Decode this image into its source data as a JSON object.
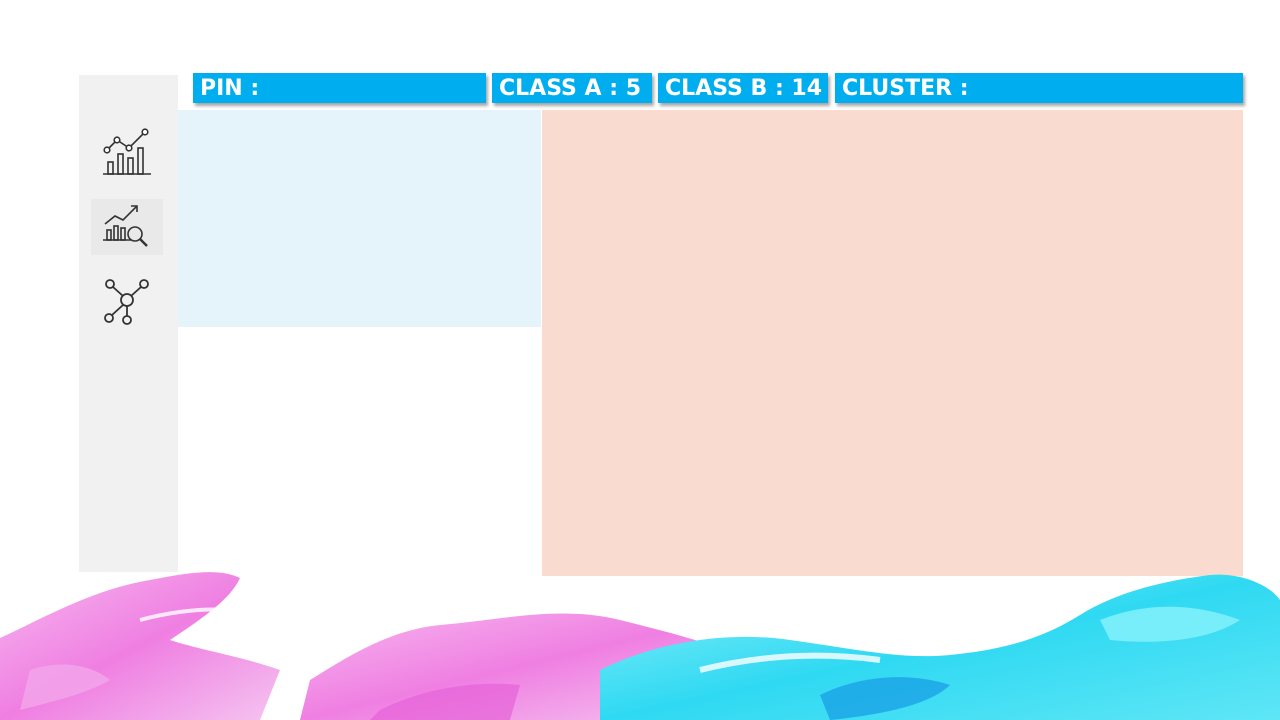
{
  "header": {
    "pin": {
      "label": "PIN :",
      "value": ""
    },
    "class_a": {
      "label": "CLASS A : 5"
    },
    "class_b": {
      "label": "CLASS B : 14"
    },
    "cluster": {
      "label": "CLUSTER :",
      "value": ""
    }
  },
  "sidebar": {
    "items": [
      {
        "icon": "bar-line-chart-icon",
        "active": false
      },
      {
        "icon": "chart-analytics-search-icon",
        "active": true
      },
      {
        "icon": "network-cluster-icon",
        "active": false
      }
    ]
  },
  "colors": {
    "header_bar": "#00aeef",
    "sidebar_bg": "#f1f1f1",
    "left_panel_bg": "#e5f3fa",
    "right_panel_bg": "#f9dbcf",
    "splash_pink": "#f08ce6",
    "splash_cyan": "#3fe3f5"
  }
}
